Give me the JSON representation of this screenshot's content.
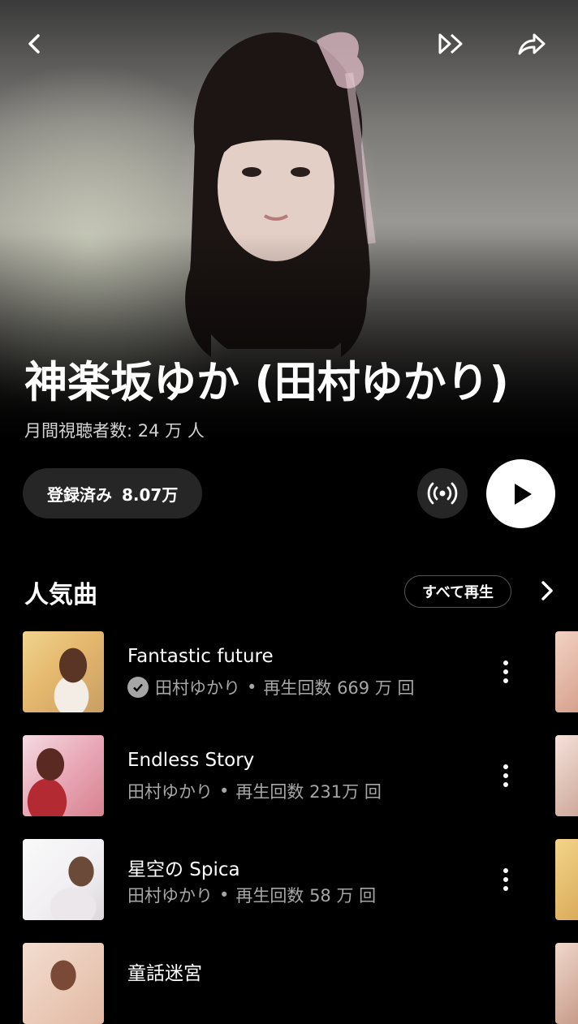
{
  "header": {
    "back_icon": "chevron-left-icon",
    "radio_icon": "double-chevron-right-icon",
    "share_icon": "share-arrow-icon"
  },
  "artist": {
    "name": "神楽坂ゆか (田村ゆかり)",
    "monthly_listeners": "月間視聴者数: 24 万 人"
  },
  "actions": {
    "subscribed_label": "登録済み",
    "subscriber_count": "8.07万",
    "cast_icon": "broadcast-icon",
    "play_icon": "play-icon"
  },
  "popular": {
    "title": "人気曲",
    "play_all_label": "すべて再生",
    "more_icon": "chevron-right-icon",
    "songs": [
      {
        "title": "Fantastic future",
        "artist": "田村ゆかり",
        "plays": "再生回数 669 万 回",
        "verified": true
      },
      {
        "title": "Endless Story",
        "artist": "田村ゆかり",
        "plays": "再生回数 231万 回",
        "verified": false
      },
      {
        "title": "星空の Spica",
        "artist": "田村ゆかり",
        "plays": "再生回数 58 万 回",
        "verified": false
      },
      {
        "title": "童話迷宮",
        "artist": "",
        "plays": "",
        "verified": false
      }
    ]
  },
  "separator": "•",
  "colors": {
    "background": "#000000",
    "button_dark": "#262626",
    "secondary_text": "#a6a6a6"
  }
}
